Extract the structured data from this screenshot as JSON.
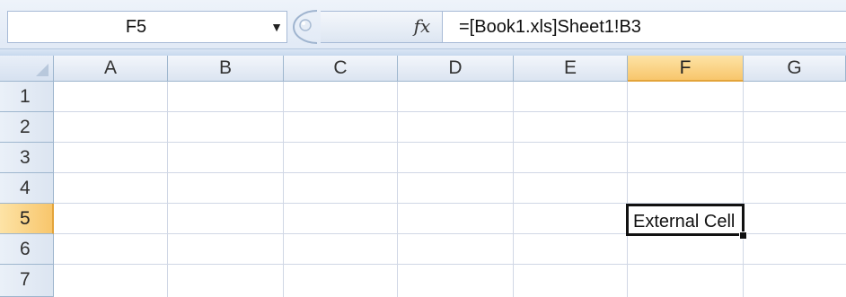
{
  "formula_bar": {
    "name_box": "F5",
    "fx_symbol": "fx",
    "formula": "=[Book1.xls]Sheet1!B3"
  },
  "columns": [
    "A",
    "B",
    "C",
    "D",
    "E",
    "F",
    "G"
  ],
  "rows": [
    "1",
    "2",
    "3",
    "4",
    "5",
    "6",
    "7"
  ],
  "active_cell": {
    "column": "F",
    "row": "5",
    "text": "External Cell"
  },
  "colors": {
    "header_active": "#f8c66c",
    "gridline": "#d0d7e5",
    "header_border": "#9eb6ce"
  }
}
